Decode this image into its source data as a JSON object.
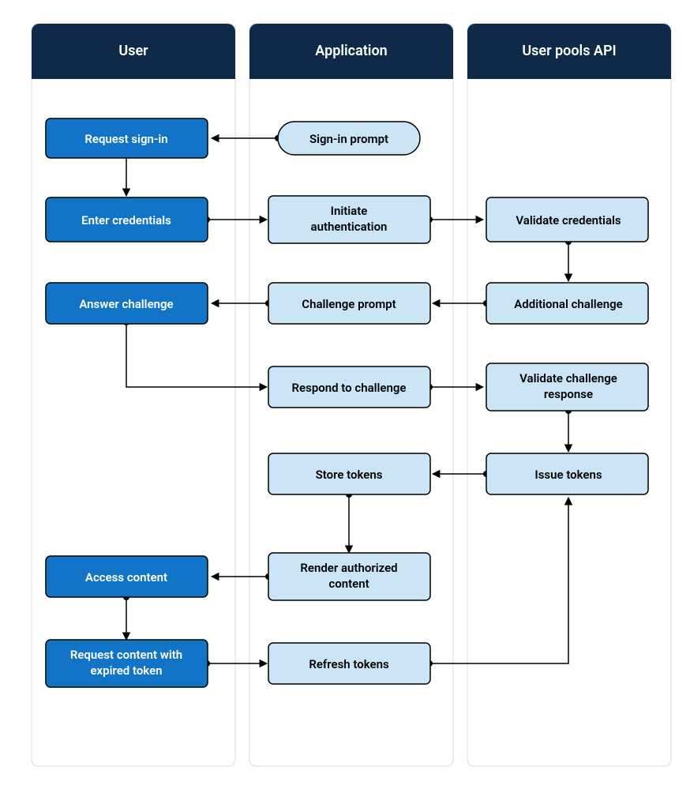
{
  "lanes": {
    "user": {
      "title": "User"
    },
    "app": {
      "title": "Application"
    },
    "api": {
      "title": "User pools API"
    }
  },
  "nodes": {
    "request_signin": {
      "label": "Request sign-in"
    },
    "signin_prompt": {
      "label": "Sign-in prompt"
    },
    "enter_credentials": {
      "label": "Enter credentials"
    },
    "initiate_auth": {
      "line1": "Initiate",
      "line2": "authentication"
    },
    "validate_credentials": {
      "label": "Validate credentials"
    },
    "answer_challenge": {
      "label": "Answer challenge"
    },
    "challenge_prompt": {
      "label": "Challenge prompt"
    },
    "additional_challenge": {
      "label": "Additional challenge"
    },
    "respond_challenge": {
      "label": "Respond to challenge"
    },
    "validate_resp": {
      "line1": "Validate challenge",
      "line2": "response"
    },
    "store_tokens": {
      "label": "Store tokens"
    },
    "issue_tokens": {
      "label": "Issue tokens"
    },
    "render_content": {
      "line1": "Render authorized",
      "line2": "content"
    },
    "access_content": {
      "label": "Access content"
    },
    "request_expired": {
      "line1": "Request content with",
      "line2": "expired token"
    },
    "refresh_tokens": {
      "label": "Refresh tokens"
    }
  }
}
